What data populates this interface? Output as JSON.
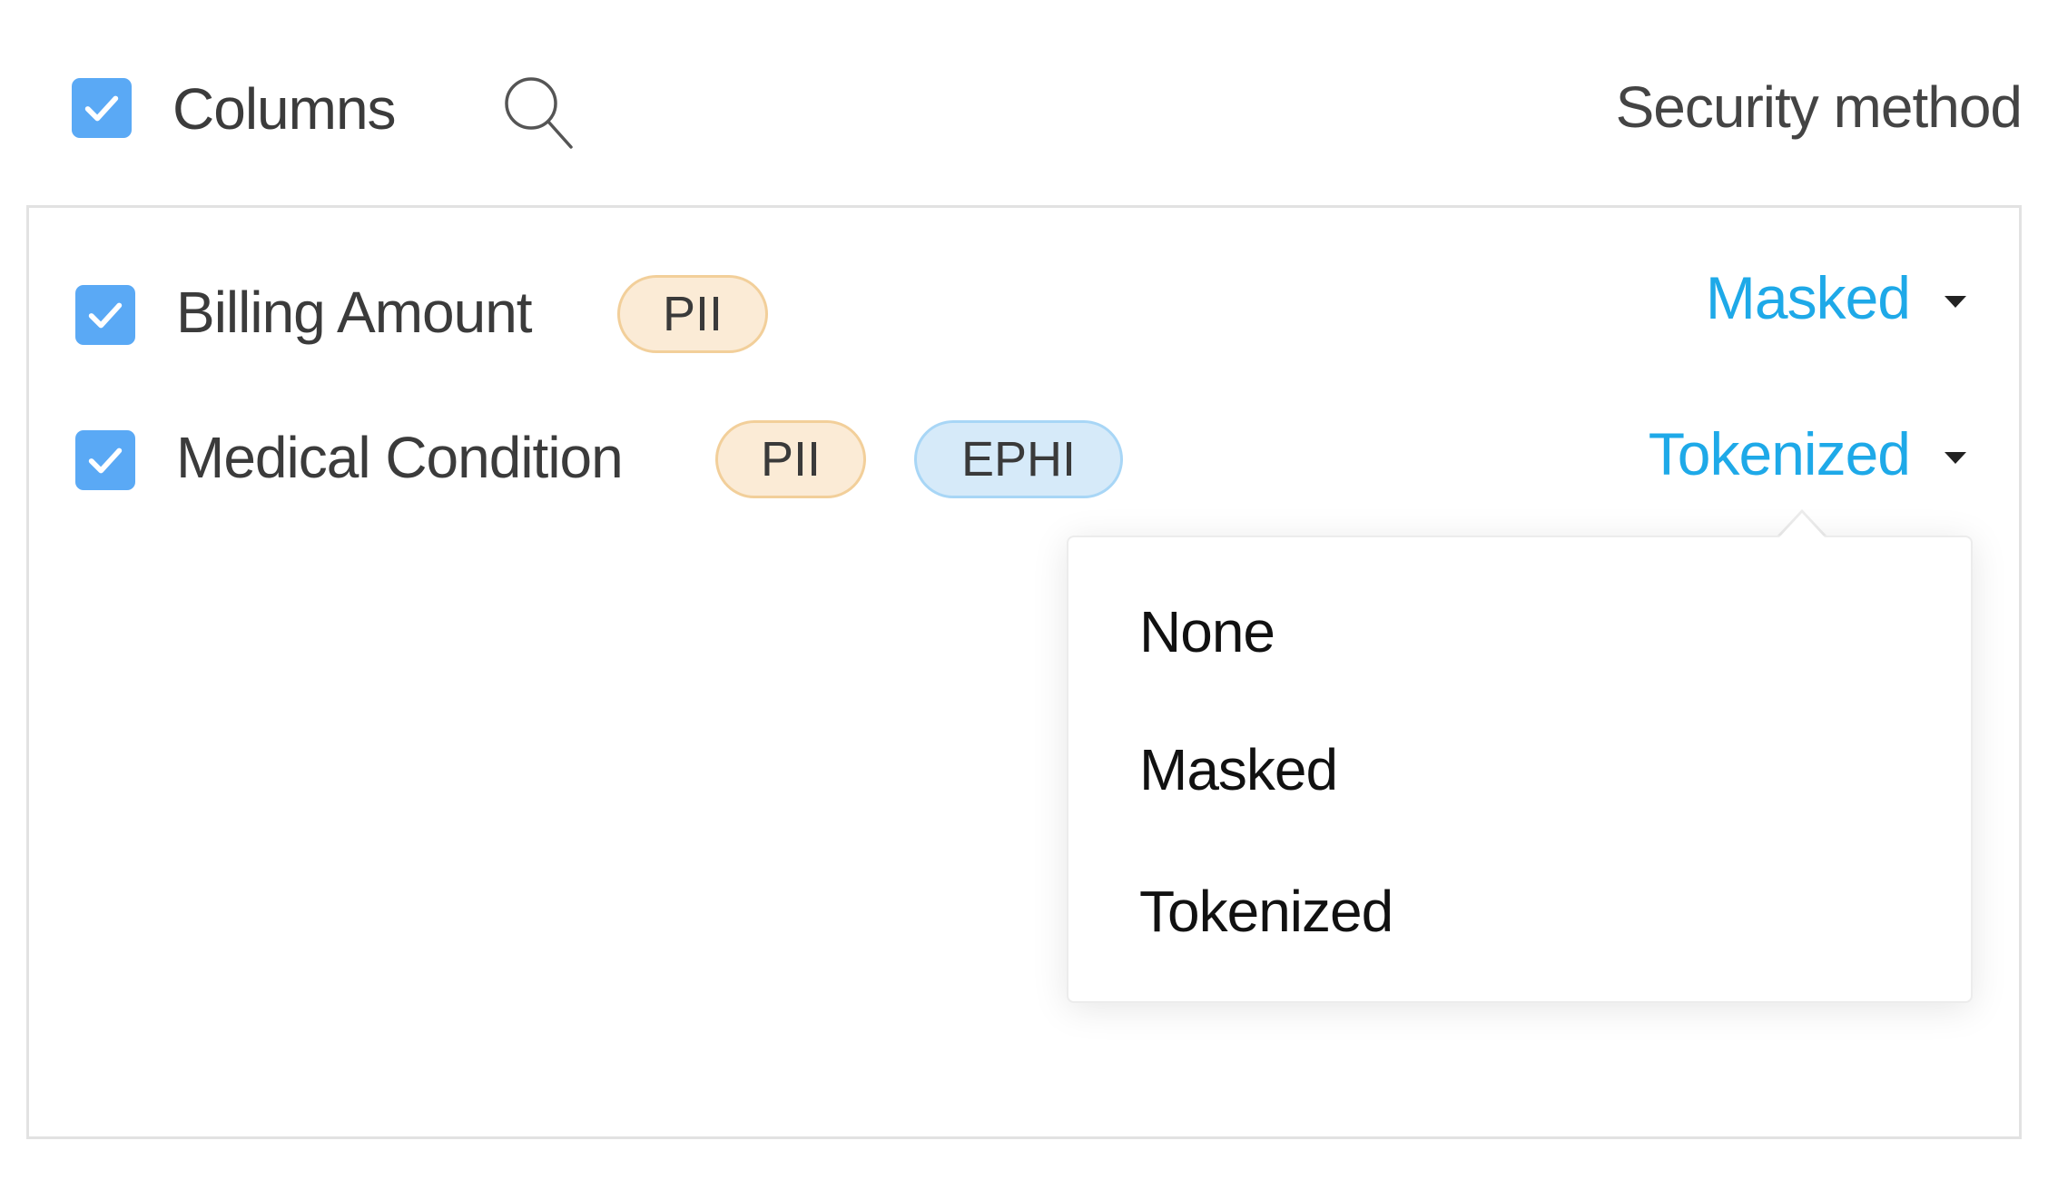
{
  "header": {
    "select_all_checked": true,
    "columns_label": "Columns",
    "search_icon": "search-icon",
    "security_method_label": "Security method"
  },
  "rows": [
    {
      "checked": true,
      "name": "Billing Amount",
      "tags": [
        "PII"
      ],
      "security_method": "Masked"
    },
    {
      "checked": true,
      "name": "Medical Condition",
      "tags": [
        "PII",
        "EPHI"
      ],
      "security_method": "Tokenized"
    }
  ],
  "dropdown": {
    "open_for_row": 1,
    "options": [
      "None",
      "Masked",
      "Tokenized"
    ]
  },
  "colors": {
    "checkbox": "#5aa9f5",
    "link": "#1ea9e8",
    "pii_bg": "#fbebd6",
    "pii_border": "#f2cf9a",
    "ephi_bg": "#d6eaf9",
    "ephi_border": "#a8d6f6"
  }
}
